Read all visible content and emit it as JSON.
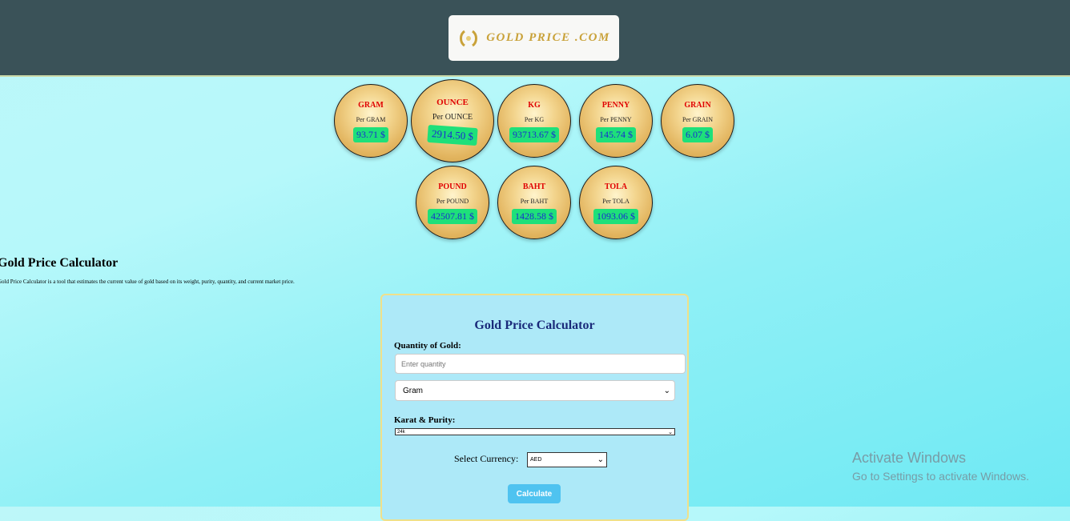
{
  "header": {
    "logo_text": "GOLD PRICE .COM"
  },
  "coins": [
    {
      "title": "GRAM",
      "sub": "Per GRAM",
      "price": "93.71 $"
    },
    {
      "title": "OUNCE",
      "sub": "Per OUNCE",
      "price": "2914.50 $"
    },
    {
      "title": "KG",
      "sub": "Per KG",
      "price": "93713.67 $"
    },
    {
      "title": "PENNY",
      "sub": "Per PENNY",
      "price": "145.74 $"
    },
    {
      "title": "GRAIN",
      "sub": "Per GRAIN",
      "price": "6.07 $"
    },
    {
      "title": "POUND",
      "sub": "Per POUND",
      "price": "42507.81 $"
    },
    {
      "title": "BAHT",
      "sub": "Per BAHT",
      "price": "1428.58 $"
    },
    {
      "title": "TOLA",
      "sub": "Per TOLA",
      "price": "1093.06 $"
    }
  ],
  "intro": {
    "title": "Gold Price Calculator",
    "text": "Gold Price Calculator is a tool that estimates the current value of gold based on its weight, purity, quantity, and current market price."
  },
  "calculator": {
    "title": "Gold Price Calculator",
    "quantity_label": "Quantity of Gold:",
    "quantity_placeholder": "Enter quantity",
    "unit_value": "Gram",
    "karat_label": "Karat & Purity:",
    "karat_value": "24k",
    "currency_label": "Select Currency:",
    "currency_value": "AED",
    "button_label": "Calculate"
  },
  "watermark": {
    "line1": "Activate Windows",
    "line2": "Go to Settings to activate Windows."
  },
  "colors": {
    "header_bg": "#3a5258",
    "coin_title": "#e00000",
    "price_bg": "#1ee07a",
    "button": "#4fc3f0"
  }
}
